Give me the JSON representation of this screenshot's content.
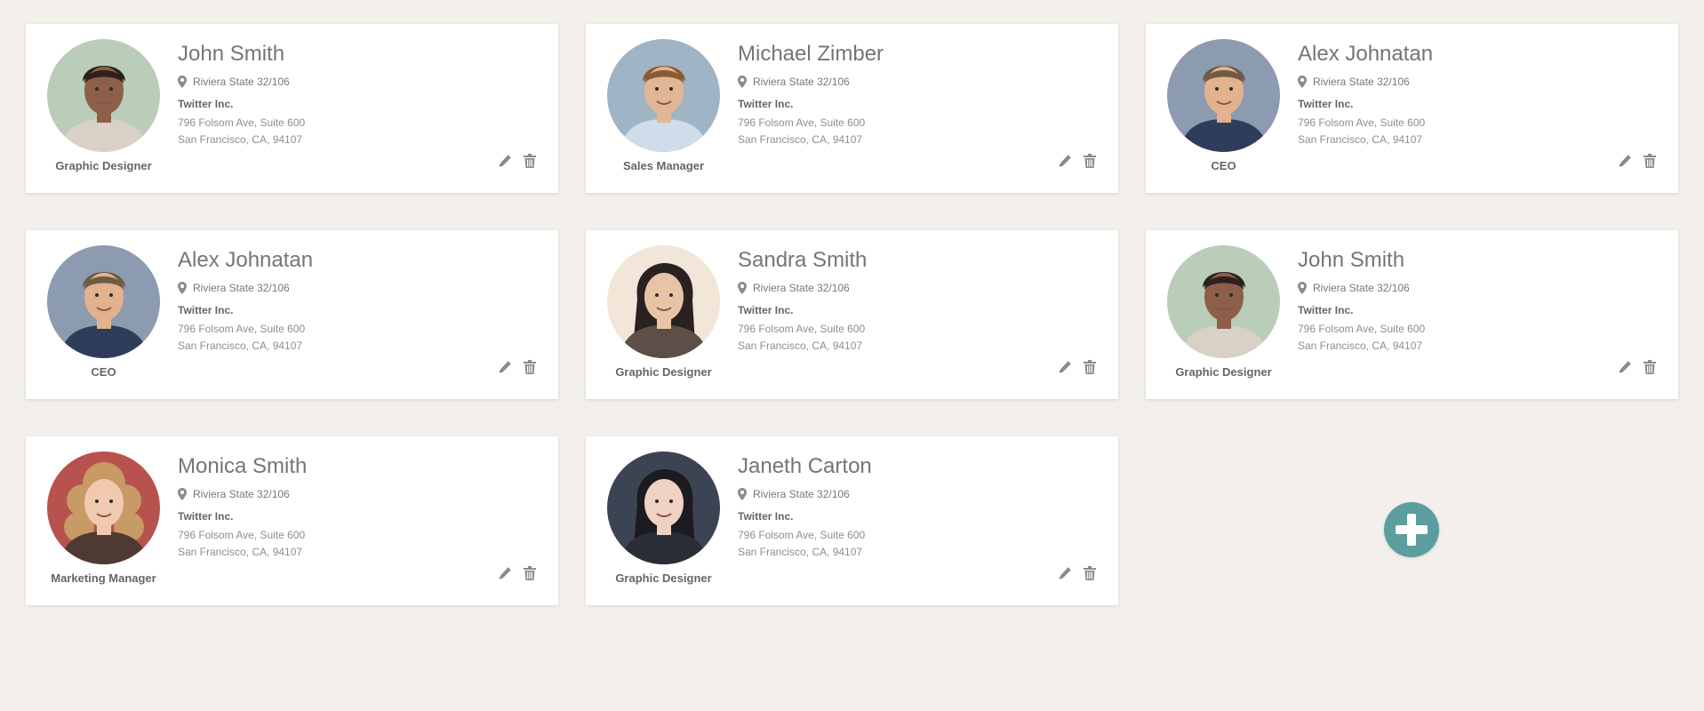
{
  "contacts": [
    {
      "name": "John Smith",
      "location": "Riviera State 32/106",
      "company": "Twitter Inc.",
      "address1": "796 Folsom Ave, Suite 600",
      "address2": "San Francisco, CA, 94107",
      "role": "Graphic Designer",
      "avatar": {
        "bg": "#b9cdb8",
        "skin": "#8d5f48",
        "hair": "#2c211d",
        "shirt": "#d7d2c5",
        "style": "short"
      }
    },
    {
      "name": "Michael Zimber",
      "location": "Riviera State 32/106",
      "company": "Twitter Inc.",
      "address1": "796 Folsom Ave, Suite 600",
      "address2": "San Francisco, CA, 94107",
      "role": "Sales Manager",
      "avatar": {
        "bg": "#9fb4c4",
        "skin": "#e1b696",
        "hair": "#8a5b34",
        "shirt": "#cfdcea",
        "style": "short"
      }
    },
    {
      "name": "Alex Johnatan",
      "location": "Riviera State 32/106",
      "company": "Twitter Inc.",
      "address1": "796 Folsom Ave, Suite 600",
      "address2": "San Francisco, CA, 94107",
      "role": "CEO",
      "avatar": {
        "bg": "#8c9bb0",
        "skin": "#e2b28f",
        "hair": "#6f5a44",
        "shirt": "#2f3d5a",
        "style": "short"
      }
    },
    {
      "name": "Alex Johnatan",
      "location": "Riviera State 32/106",
      "company": "Twitter Inc.",
      "address1": "796 Folsom Ave, Suite 600",
      "address2": "San Francisco, CA, 94107",
      "role": "CEO",
      "avatar": {
        "bg": "#8c9bb0",
        "skin": "#e2b28f",
        "hair": "#6f5a44",
        "shirt": "#2f3d5a",
        "style": "short"
      }
    },
    {
      "name": "Sandra Smith",
      "location": "Riviera State 32/106",
      "company": "Twitter Inc.",
      "address1": "796 Folsom Ave, Suite 600",
      "address2": "San Francisco, CA, 94107",
      "role": "Graphic Designer",
      "avatar": {
        "bg": "#f1e6d8",
        "skin": "#e8c4a6",
        "hair": "#2a2220",
        "shirt": "#5e4e48",
        "style": "long"
      }
    },
    {
      "name": "John Smith",
      "location": "Riviera State 32/106",
      "company": "Twitter Inc.",
      "address1": "796 Folsom Ave, Suite 600",
      "address2": "San Francisco, CA, 94107",
      "role": "Graphic Designer",
      "avatar": {
        "bg": "#b9cdb8",
        "skin": "#8d5f48",
        "hair": "#2c211d",
        "shirt": "#d7d2c5",
        "style": "short"
      }
    },
    {
      "name": "Monica Smith",
      "location": "Riviera State 32/106",
      "company": "Twitter Inc.",
      "address1": "796 Folsom Ave, Suite 600",
      "address2": "San Francisco, CA, 94107",
      "role": "Marketing Manager",
      "avatar": {
        "bg": "#b8524e",
        "skin": "#f0c9ae",
        "hair": "#c79a66",
        "shirt": "#4f3a32",
        "style": "curly"
      }
    },
    {
      "name": "Janeth Carton",
      "location": "Riviera State 32/106",
      "company": "Twitter Inc.",
      "address1": "796 Folsom Ave, Suite 600",
      "address2": "San Francisco, CA, 94107",
      "role": "Graphic Designer",
      "avatar": {
        "bg": "#3c4453",
        "skin": "#f0d2c2",
        "hair": "#1b1b20",
        "shirt": "#2a2d36",
        "style": "long"
      }
    }
  ],
  "icons": {
    "location": "map-marker-icon",
    "edit": "pencil-icon",
    "delete": "trash-icon",
    "add": "plus-icon"
  },
  "colors": {
    "background": "#f3f0ec",
    "card": "#ffffff",
    "accent": "#5c9ea0",
    "icon": "#8a8a8a"
  }
}
